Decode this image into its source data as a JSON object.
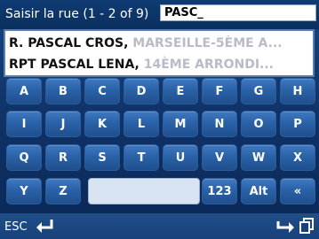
{
  "header": {
    "label": "Saisir la rue (1 - 2 of 9)",
    "search_value": "PASC_"
  },
  "results": [
    {
      "primary": "R. PASCAL CROS,",
      "secondary": " MARSEILLE-5ÈME A..."
    },
    {
      "primary": "RPT PASCAL LENA,",
      "secondary": " 14ÈME ARRONDI..."
    }
  ],
  "keyboard": {
    "row1": [
      "A",
      "B",
      "C",
      "D",
      "E",
      "F",
      "G",
      "H"
    ],
    "row2": [
      "I",
      "J",
      "K",
      "L",
      "M",
      "N",
      "O",
      "P"
    ],
    "row3": [
      "Q",
      "R",
      "S",
      "T",
      "U",
      "V",
      "W",
      "X"
    ],
    "row4": [
      "Y",
      "Z"
    ],
    "numeric_label": "123",
    "alt_label": "Alt",
    "back_label": "«"
  },
  "footer": {
    "esc_label": "ESC",
    "icons": [
      "back-arrow-icon",
      "enter-arrow-icon",
      "copy-icon"
    ]
  },
  "colors": {
    "key_face": "#2a62a8",
    "background": "#0f3166",
    "secondary_text": "#b7bcc6"
  }
}
